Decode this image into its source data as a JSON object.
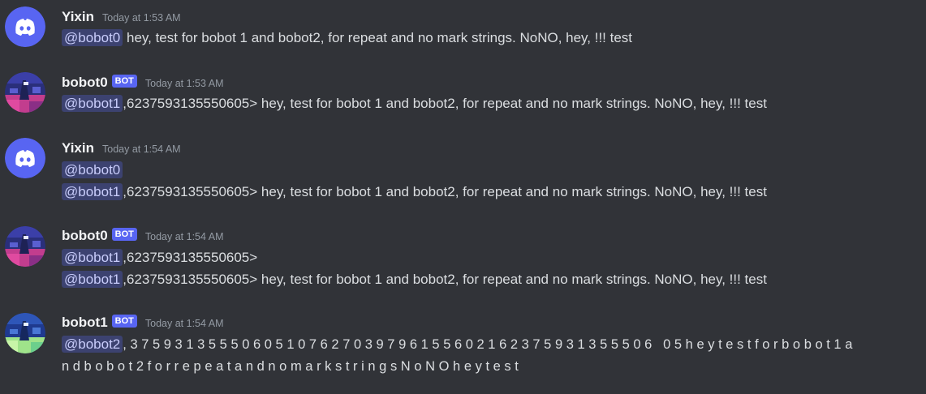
{
  "messages": [
    {
      "author": "Yixin",
      "avatar": "discord-logo-avatar",
      "bot": false,
      "timestamp": "Today at 1:53 AM",
      "lines": [
        {
          "mention": "@bobot0",
          "text": " hey, test for bobot 1 and bobot2, for repeat and no mark strings. NoNO, hey, !!! test"
        }
      ]
    },
    {
      "author": "bobot0",
      "avatar": "pixel-art-avatar",
      "bot": true,
      "bot_tag": "BOT",
      "timestamp": "Today at 1:53 AM",
      "lines": [
        {
          "mention": "@bobot1",
          "text": ",6237593135550605> hey, test for bobot 1 and bobot2, for repeat and no mark strings. NoNO, hey, !!! test"
        }
      ]
    },
    {
      "author": "Yixin",
      "avatar": "discord-logo-avatar",
      "bot": false,
      "timestamp": "Today at 1:54 AM",
      "lines": [
        {
          "mention": "@bobot0",
          "text": ""
        },
        {
          "mention": "@bobot1",
          "text": ",6237593135550605> hey, test for bobot 1 and bobot2, for repeat and no mark strings. NoNO, hey, !!! test"
        }
      ]
    },
    {
      "author": "bobot0",
      "avatar": "pixel-art-avatar",
      "bot": true,
      "bot_tag": "BOT",
      "timestamp": "Today at 1:54 AM",
      "lines": [
        {
          "mention": "@bobot1",
          "text": ",6237593135550605>"
        },
        {
          "mention": "@bobot1",
          "text": ",6237593135550605> hey, test for bobot 1 and bobot2, for repeat and no mark strings. NoNO, hey, !!! test"
        }
      ]
    },
    {
      "author": "bobot1",
      "avatar": "pixel-art-avatar-green",
      "bot": true,
      "bot_tag": "BOT",
      "timestamp": "Today at 1:54 AM",
      "lines": [
        {
          "mention": "@bobot2",
          "text": ",37593135550605107627039796155602162375931355506 05heytestforbobot1a"
        },
        {
          "mention": "",
          "text": "ndbobot2forrepeatandnomarkstringsNoNOheytest"
        }
      ]
    }
  ],
  "colors": {
    "background": "#313338",
    "blurple": "#5865f2",
    "mention_bg": "#3c4270",
    "mention_fg": "#c9cdfb",
    "timestamp": "#949ba4",
    "username": "#f2f3f5",
    "text": "#dbdee1"
  }
}
